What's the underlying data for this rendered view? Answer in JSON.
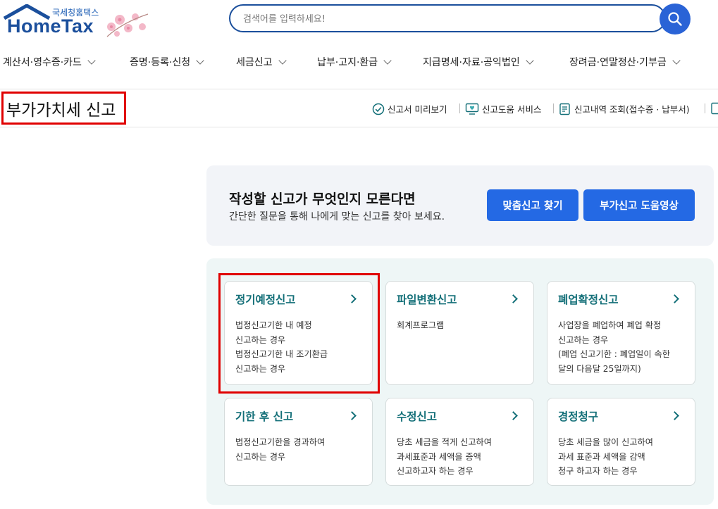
{
  "header": {
    "logo_sub": "국세청홈택스",
    "logo_main": "HomeTax",
    "search_placeholder": "검색어를 입력하세요!"
  },
  "nav": [
    {
      "label": "계산서·영수증·카드"
    },
    {
      "label": "증명·등록·신청"
    },
    {
      "label": "세금신고"
    },
    {
      "label": "납부·고지·환급"
    },
    {
      "label": "지급명세·자료·공익법인"
    },
    {
      "label": "장려금·연말정산·기부금"
    }
  ],
  "page_title": "부가가치세 신고",
  "utilities": [
    {
      "label": "신고서 미리보기",
      "icon": "check-circle-icon"
    },
    {
      "label": "신고도움 서비스",
      "icon": "monitor-heart-icon"
    },
    {
      "label": "신고내역 조회(접수증 · 납부서)",
      "icon": "document-list-icon"
    }
  ],
  "banner": {
    "title": "작성할 신고가 무엇인지 모른다면",
    "desc": "간단한 질문을 통해 나에게 맞는 신고를 찾아 보세요.",
    "btn_find": "맞춤신고 찾기",
    "btn_video": "부가신고 도움영상"
  },
  "cards": [
    {
      "title": "정기예정신고",
      "lines": [
        "법정신고기한 내 예정",
        "신고하는 경우",
        "법정신고기한 내 조기환급",
        "신고하는 경우"
      ]
    },
    {
      "title": "파일변환신고",
      "lines": [
        "회계프로그램"
      ]
    },
    {
      "title": "폐업확정신고",
      "lines": [
        "사업장을 폐업하여 폐업 확정",
        "신고하는 경우",
        "(폐업 신고기한 : 폐업일이 속한",
        "달의 다음달 25일까지)"
      ]
    },
    {
      "title": "기한 후 신고",
      "lines": [
        "법정신고기한을 경과하여",
        "신고하는 경우"
      ]
    },
    {
      "title": "수정신고",
      "lines": [
        "당초 세금을 적게 신고하여",
        "과세표준과 세액을 증액",
        "신고하고자 하는 경우"
      ]
    },
    {
      "title": "경정청구",
      "lines": [
        "당초 세금을 많이 신고하여",
        "과세 표준과 세액을 감액",
        "청구 하고자 하는 경우"
      ]
    }
  ],
  "colors": {
    "brand_navy": "#1b4f9c",
    "primary_blue": "#2469e4",
    "card_title_teal": "#136f78",
    "highlight_red": "#e00000"
  }
}
